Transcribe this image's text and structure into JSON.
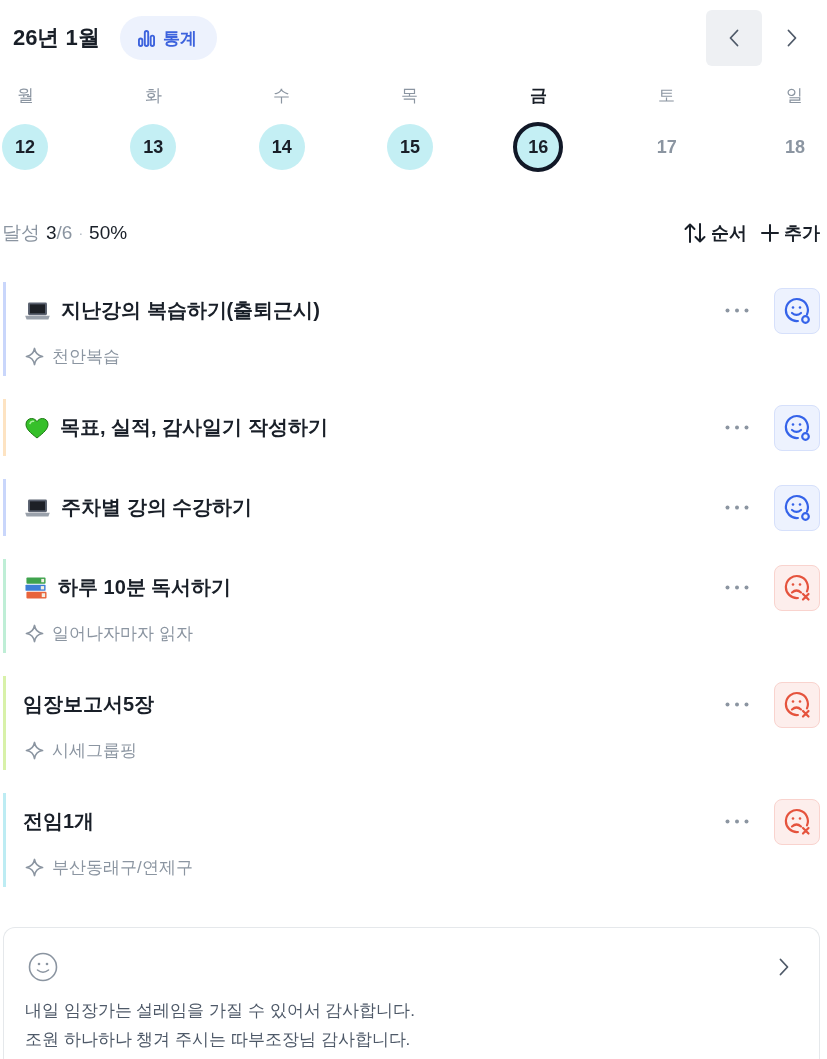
{
  "header": {
    "title": "26년 1월",
    "stats_button": {
      "label": "통계"
    }
  },
  "week": [
    {
      "weekday": "월",
      "day": "12",
      "filled": true,
      "selected": false
    },
    {
      "weekday": "화",
      "day": "13",
      "filled": true,
      "selected": false
    },
    {
      "weekday": "수",
      "day": "14",
      "filled": true,
      "selected": false
    },
    {
      "weekday": "목",
      "day": "15",
      "filled": true,
      "selected": false
    },
    {
      "weekday": "금",
      "day": "16",
      "filled": true,
      "selected": true
    },
    {
      "weekday": "토",
      "day": "17",
      "filled": false,
      "selected": false
    },
    {
      "weekday": "일",
      "day": "18",
      "filled": false,
      "selected": false
    }
  ],
  "summary": {
    "label": "달성",
    "done": "3",
    "total": "/6",
    "separator": "·",
    "percent": "50%"
  },
  "actions": {
    "sort": "순서",
    "add": "추가"
  },
  "tasks": [
    {
      "kind": "laptop",
      "title": "지난강의 복습하기(출퇴근시)",
      "note": "천안복습",
      "color": "#c9d6fb",
      "done": true
    },
    {
      "kind": "heart",
      "title": "목표, 실적, 감사일기 작성하기",
      "color": "#fde3c2",
      "done": true
    },
    {
      "kind": "laptop",
      "title": "주차별 강의 수강하기",
      "color": "#c9d6fb",
      "done": true
    },
    {
      "kind": "books",
      "title": "하루 10분 독서하기",
      "note": "일어나자마자 읽자",
      "color": "#bfeed6",
      "done": false
    },
    {
      "kind": "plain",
      "title": "임장보고서5장",
      "note": "시세그룹핑",
      "color": "#d8f1a9",
      "done": false
    },
    {
      "kind": "plain",
      "title": "전임1개",
      "note": "부산동래구/연제구",
      "color": "#bdecf3",
      "done": false
    }
  ],
  "gratitude": {
    "lines": [
      "내일 임장가는 설레임을 가질 수 있어서 감사합니다.",
      "조원 하나하나 챙겨 주시는 따부조장님 감사합니다."
    ]
  }
}
